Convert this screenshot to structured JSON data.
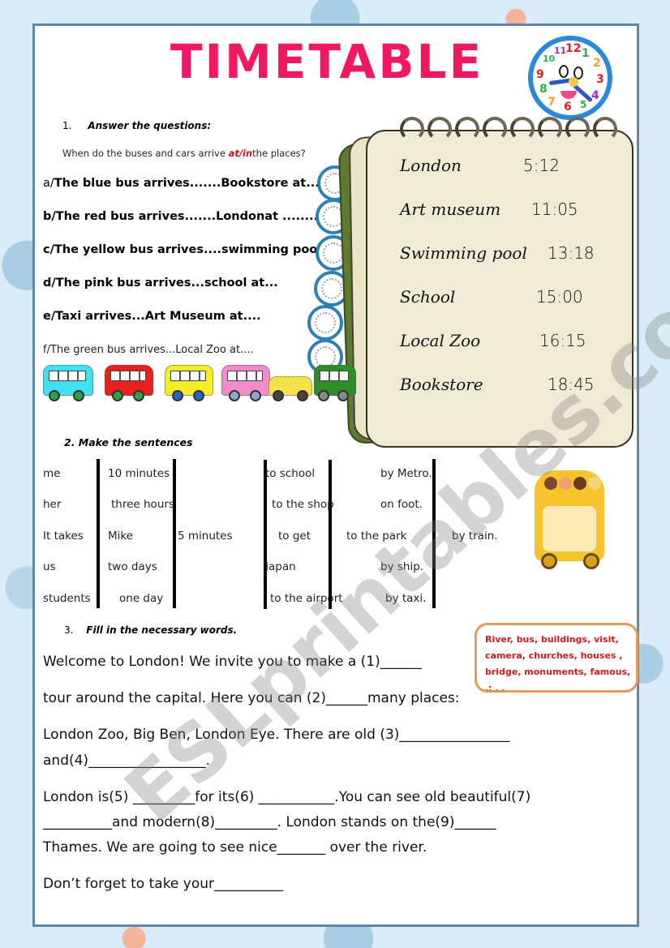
{
  "title": "TIMETABLE",
  "question1": {
    "number": "1.",
    "label": "Answer the questions:",
    "subtitle_before": "When do the buses and cars arrive ",
    "subtitle_accent": "at/in",
    "subtitle_after": "the places?",
    "lines": [
      {
        "prefix": "a/",
        "text": "The blue  bus  arrives.......Bookstore at..... ......"
      },
      {
        "prefix": "",
        "text": "b/The red bus arrives.......Londonat  ........."
      },
      {
        "prefix": "",
        "text": "c/The yellow bus arrives....swimming pool at"
      },
      {
        "prefix": "",
        "text": "d/The pink bus arrives...school at..."
      },
      {
        "prefix": "",
        "text": "e/Taxi arrives...Art Museum at...."
      },
      {
        "prefix": "",
        "text": "f/The green bus arrives...Local Zoo at...."
      }
    ],
    "vehicles": [
      {
        "name": "blue bus",
        "color": "#3fe0f0"
      },
      {
        "name": "red bus",
        "color": "#e82020"
      },
      {
        "name": "yellow bus",
        "color": "#f3ee2a"
      },
      {
        "name": "pink bus",
        "color": "#f28cc8"
      },
      {
        "name": "taxi",
        "color": "#f5e24a"
      },
      {
        "name": "green bus",
        "color": "#2f8c2a"
      }
    ]
  },
  "timetable": [
    {
      "place": "London",
      "time": "5:12"
    },
    {
      "place": "Art museum",
      "time": "11:05"
    },
    {
      "place": "Swimming pool",
      "time": "13:18"
    },
    {
      "place": "School",
      "time": "15:00"
    },
    {
      "place": "Local Zoo",
      "time": "16:15"
    },
    {
      "place": "Bookstore",
      "time": "18:45"
    }
  ],
  "question2": {
    "label": "2.  Make the sentences",
    "col1": [
      "me",
      "her",
      "It takes",
      "us",
      "students"
    ],
    "col2": [
      "10 minutes",
      "three hours",
      "Mike",
      "two days",
      "one day"
    ],
    "col3": [
      "",
      "",
      "5 minutes",
      "",
      ""
    ],
    "col4": [
      "to school",
      "to the shop",
      "to get",
      "Japan",
      "to the airport"
    ],
    "col5": [
      "by  Metro.",
      "on foot.",
      "to the park",
      "by ship.",
      "by taxi."
    ],
    "col6": [
      "",
      "",
      "by train.",
      "",
      ""
    ]
  },
  "question3": {
    "number": "3.",
    "label": "Fill in the necessary words.",
    "word_box": [
      "River,  bus,  buildings,  visit,",
      "camera, churches,  houses  ,",
      "bridge,  monuments, famous,",
      "   .:    .    ."
    ],
    "paragraph": [
      "Welcome to London!   We invite you to make a (1)______",
      "tour around the capital. Here you can (2)______many  places:",
      "London Zoo, Big Ben, London Eye. There are old (3)________________",
      "and(4)_________________.",
      "London is(5) _________for its(6) ___________.You can see old beautiful(7)",
      "__________and modern(8)_________. London stands on the(9)______",
      "Thames. We are going to see nice_______ over the river.",
      "Don’t forget to take your__________"
    ]
  },
  "watermark": "ESLprintables.com",
  "colors": {
    "title": "#f0185f",
    "accent": "#c0141e",
    "border": "#5d86b3",
    "word_box_border": "#e59a55",
    "word_box_text": "#d21a1a"
  }
}
